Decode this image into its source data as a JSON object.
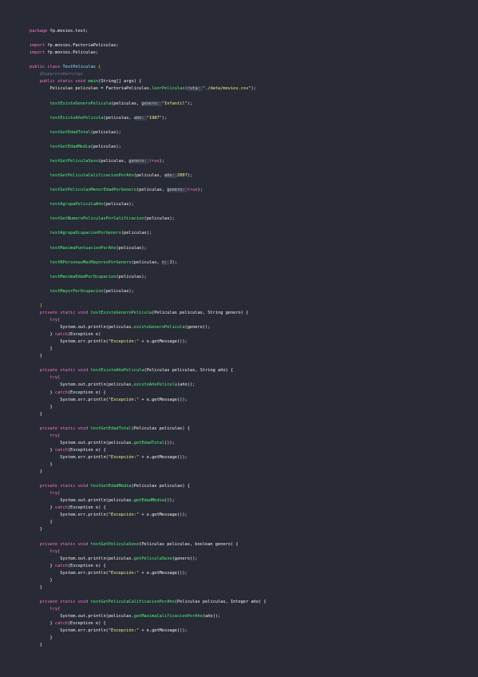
{
  "colors": {
    "background": "#282a36",
    "keyword": "#ff79c6",
    "type": "#8be9fd",
    "method": "#50fa7b",
    "string": "#f1fa8c",
    "plain": "#f8f8f2",
    "annotation": "#6272a4"
  },
  "code_lines": [
    [
      {
        "t": "package ",
        "k": "kw"
      },
      {
        "t": "fp.movies.test;",
        "k": "pl"
      }
    ],
    [],
    [
      {
        "t": "import ",
        "k": "kw"
      },
      {
        "t": "fp.movies.FactoriaPeliculas;",
        "k": "pl"
      }
    ],
    [
      {
        "t": "import ",
        "k": "kw"
      },
      {
        "t": "fp.movies.Peliculas;",
        "k": "pl"
      }
    ],
    [],
    [
      {
        "t": "public ",
        "k": "kw"
      },
      {
        "t": "class ",
        "k": "kw"
      },
      {
        "t": "TestPeliculas ",
        "k": "ty"
      },
      {
        "t": "{",
        "k": "br"
      }
    ],
    [
      {
        "t": "    @SuppressWarnings",
        "k": "an"
      }
    ],
    [
      {
        "t": "    public static void ",
        "k": "kw"
      },
      {
        "t": "main",
        "k": "fn"
      },
      {
        "t": "(String[] ",
        "k": "pl"
      },
      {
        "t": "args",
        "k": "pl"
      },
      {
        "t": ") {",
        "k": "pl"
      }
    ],
    [
      {
        "t": "        Peliculas peliculas = FactoriaPeliculas.",
        "k": "pl"
      },
      {
        "t": "leerPeliculas",
        "k": "fn"
      },
      {
        "t": "(",
        "k": "pl"
      },
      {
        "t": "ruta: ",
        "k": "hint"
      },
      {
        "t": "\"./data/movies.csv\"",
        "k": "str"
      },
      {
        "t": ");",
        "k": "pl"
      }
    ],
    [],
    [
      {
        "t": "        ",
        "k": "pl"
      },
      {
        "t": "testExisteGeneroPelicula",
        "k": "fn"
      },
      {
        "t": "(peliculas, ",
        "k": "pl"
      },
      {
        "t": "genero: ",
        "k": "hint"
      },
      {
        "t": "\"Infantil\"",
        "k": "str"
      },
      {
        "t": ");",
        "k": "pl"
      }
    ],
    [],
    [
      {
        "t": "        ",
        "k": "pl"
      },
      {
        "t": "testExisteAñoPelicula",
        "k": "fn"
      },
      {
        "t": "(peliculas, ",
        "k": "pl"
      },
      {
        "t": "año: ",
        "k": "hint"
      },
      {
        "t": "\"1987\"",
        "k": "str"
      },
      {
        "t": ");",
        "k": "pl"
      }
    ],
    [],
    [
      {
        "t": "        ",
        "k": "pl"
      },
      {
        "t": "testGetEdadTotal",
        "k": "fn"
      },
      {
        "t": "(peliculas);",
        "k": "pl"
      }
    ],
    [],
    [
      {
        "t": "        ",
        "k": "pl"
      },
      {
        "t": "testGetEdadMedia",
        "k": "fn"
      },
      {
        "t": "(peliculas);",
        "k": "pl"
      }
    ],
    [],
    [
      {
        "t": "        ",
        "k": "pl"
      },
      {
        "t": "testGetPeliculaSexo",
        "k": "fn"
      },
      {
        "t": "(peliculas, ",
        "k": "pl"
      },
      {
        "t": "genero: ",
        "k": "hint"
      },
      {
        "t": "true",
        "k": "kw"
      },
      {
        "t": ");",
        "k": "pl"
      }
    ],
    [],
    [
      {
        "t": "        ",
        "k": "pl"
      },
      {
        "t": "testGetPeliculaCalificacionPorAño",
        "k": "fn"
      },
      {
        "t": "(peliculas, ",
        "k": "pl"
      },
      {
        "t": "año: ",
        "k": "hint"
      },
      {
        "t": "2007",
        "k": "str"
      },
      {
        "t": ");",
        "k": "pl"
      }
    ],
    [],
    [
      {
        "t": "        ",
        "k": "pl"
      },
      {
        "t": "testGetPeliculasMenorEdadPorGenero",
        "k": "fn"
      },
      {
        "t": "(peliculas, ",
        "k": "pl"
      },
      {
        "t": "genero: ",
        "k": "hint"
      },
      {
        "t": "true",
        "k": "kw"
      },
      {
        "t": ");",
        "k": "pl"
      }
    ],
    [],
    [
      {
        "t": "        ",
        "k": "pl"
      },
      {
        "t": "testAgrupaPeliculaAño",
        "k": "fn"
      },
      {
        "t": "(peliculas);",
        "k": "pl"
      }
    ],
    [],
    [
      {
        "t": "        ",
        "k": "pl"
      },
      {
        "t": "testGetNumeroPeliculasPorCalificacion",
        "k": "fn"
      },
      {
        "t": "(peliculas);",
        "k": "pl"
      }
    ],
    [],
    [
      {
        "t": "        ",
        "k": "pl"
      },
      {
        "t": "testAgrupaOcupacionPorGenero",
        "k": "fn"
      },
      {
        "t": "(peliculas);",
        "k": "pl"
      }
    ],
    [],
    [
      {
        "t": "        ",
        "k": "pl"
      },
      {
        "t": "testMaximaPuntuacionPorAño",
        "k": "fn"
      },
      {
        "t": "(peliculas);",
        "k": "pl"
      }
    ],
    [],
    [
      {
        "t": "        ",
        "k": "pl"
      },
      {
        "t": "testNPersonasMasMayoresPorGenero",
        "k": "fn"
      },
      {
        "t": "(peliculas, ",
        "k": "pl"
      },
      {
        "t": "n: ",
        "k": "hint"
      },
      {
        "t": "3",
        "k": "str"
      },
      {
        "t": ");",
        "k": "pl"
      }
    ],
    [],
    [
      {
        "t": "        ",
        "k": "pl"
      },
      {
        "t": "testMaximaEdadPorOcupacion",
        "k": "fn"
      },
      {
        "t": "(peliculas);",
        "k": "pl"
      }
    ],
    [],
    [
      {
        "t": "        ",
        "k": "pl"
      },
      {
        "t": "testMayorPorOcupacion",
        "k": "fn"
      },
      {
        "t": "(peliculas);",
        "k": "pl"
      }
    ],
    [],
    [
      {
        "t": "    }",
        "k": "br"
      }
    ],
    [
      {
        "t": "    private static void ",
        "k": "kw"
      },
      {
        "t": "testExisteGeneroPelicula",
        "k": "fn"
      },
      {
        "t": "(Peliculas peliculas, String genero) {",
        "k": "pl"
      }
    ],
    [
      {
        "t": "        try{",
        "k": "kw"
      }
    ],
    [
      {
        "t": "            System.out.println(peliculas.",
        "k": "pl"
      },
      {
        "t": "existeGeneroPelicula",
        "k": "fn"
      },
      {
        "t": "(genero));",
        "k": "pl"
      }
    ],
    [
      {
        "t": "        } ",
        "k": "pl"
      },
      {
        "t": "catch",
        "k": "kw"
      },
      {
        "t": "(Exception e)",
        "k": "pl"
      }
    ],
    [
      {
        "t": "            System.err.println(",
        "k": "pl"
      },
      {
        "t": "\"Excepción:\"",
        "k": "str"
      },
      {
        "t": " + e.getMessage());",
        "k": "pl"
      }
    ],
    [
      {
        "t": "        }",
        "k": "pl"
      }
    ],
    [
      {
        "t": "    }",
        "k": "pl"
      }
    ],
    [],
    [
      {
        "t": "    private static void ",
        "k": "kw"
      },
      {
        "t": "testExisteAñoPelicula",
        "k": "fn"
      },
      {
        "t": "(Peliculas peliculas, String año) {",
        "k": "pl"
      }
    ],
    [
      {
        "t": "        try{",
        "k": "kw"
      }
    ],
    [
      {
        "t": "            System.out.println(peliculas.",
        "k": "pl"
      },
      {
        "t": "existeAñoPelicula",
        "k": "fn"
      },
      {
        "t": "(año));",
        "k": "pl"
      }
    ],
    [
      {
        "t": "        } ",
        "k": "pl"
      },
      {
        "t": "catch",
        "k": "kw"
      },
      {
        "t": "(Exception e) {",
        "k": "pl"
      }
    ],
    [
      {
        "t": "            System.err.println(",
        "k": "pl"
      },
      {
        "t": "\"Excepción:\"",
        "k": "str"
      },
      {
        "t": " + e.getMessage());",
        "k": "pl"
      }
    ],
    [
      {
        "t": "        }",
        "k": "pl"
      }
    ],
    [
      {
        "t": "    }",
        "k": "pl"
      }
    ],
    [],
    [
      {
        "t": "    private static void ",
        "k": "kw"
      },
      {
        "t": "testGetEdadTotal",
        "k": "fn"
      },
      {
        "t": "(Peliculas peliculas) {",
        "k": "pl"
      }
    ],
    [
      {
        "t": "        try{",
        "k": "kw"
      }
    ],
    [
      {
        "t": "            System.out.println(peliculas.",
        "k": "pl"
      },
      {
        "t": "getEdadTotal",
        "k": "fn"
      },
      {
        "t": "());",
        "k": "pl"
      }
    ],
    [
      {
        "t": "        } ",
        "k": "pl"
      },
      {
        "t": "catch",
        "k": "kw"
      },
      {
        "t": "(Exception e) {",
        "k": "pl"
      }
    ],
    [
      {
        "t": "            System.err.println(",
        "k": "pl"
      },
      {
        "t": "\"Excepción:\"",
        "k": "str"
      },
      {
        "t": " + e.getMessage());",
        "k": "pl"
      }
    ],
    [
      {
        "t": "        }",
        "k": "pl"
      }
    ],
    [
      {
        "t": "    }",
        "k": "pl"
      }
    ],
    [],
    [
      {
        "t": "    private static void ",
        "k": "kw"
      },
      {
        "t": "testGetEdadMedia",
        "k": "fn"
      },
      {
        "t": "(Peliculas peliculas) {",
        "k": "pl"
      }
    ],
    [
      {
        "t": "        try{",
        "k": "kw"
      }
    ],
    [
      {
        "t": "            System.out.println(peliculas.",
        "k": "pl"
      },
      {
        "t": "getEdadMedia",
        "k": "fn"
      },
      {
        "t": "());",
        "k": "pl"
      }
    ],
    [
      {
        "t": "        } ",
        "k": "pl"
      },
      {
        "t": "catch",
        "k": "kw"
      },
      {
        "t": "(Exception e) {",
        "k": "pl"
      }
    ],
    [
      {
        "t": "            System.err.println(",
        "k": "pl"
      },
      {
        "t": "\"Excepción:\"",
        "k": "str"
      },
      {
        "t": " + e.getMessage());",
        "k": "pl"
      }
    ],
    [
      {
        "t": "        }",
        "k": "pl"
      }
    ],
    [
      {
        "t": "    }",
        "k": "pl"
      }
    ],
    [],
    [
      {
        "t": "    private static void ",
        "k": "kw"
      },
      {
        "t": "testGetPeliculaSexo",
        "k": "fn"
      },
      {
        "t": "(Peliculas peliculas, boolean genero) {",
        "k": "pl"
      }
    ],
    [
      {
        "t": "        try{",
        "k": "kw"
      }
    ],
    [
      {
        "t": "            System.out.println(peliculas.",
        "k": "pl"
      },
      {
        "t": "getPeliculaSexo",
        "k": "fn"
      },
      {
        "t": "(genero));",
        "k": "pl"
      }
    ],
    [
      {
        "t": "        } ",
        "k": "pl"
      },
      {
        "t": "catch",
        "k": "kw"
      },
      {
        "t": "(Exception e) {",
        "k": "pl"
      }
    ],
    [
      {
        "t": "            System.err.println(",
        "k": "pl"
      },
      {
        "t": "\"Excepción:\"",
        "k": "str"
      },
      {
        "t": " + e.getMessage());",
        "k": "pl"
      }
    ],
    [
      {
        "t": "        }",
        "k": "pl"
      }
    ],
    [
      {
        "t": "    }",
        "k": "pl"
      }
    ],
    [],
    [
      {
        "t": "    private static void ",
        "k": "kw"
      },
      {
        "t": "testGetPeliculaCalificacionPorAño",
        "k": "fn"
      },
      {
        "t": "(Peliculas peliculas, Integer año) {",
        "k": "pl"
      }
    ],
    [
      {
        "t": "        try{",
        "k": "kw"
      }
    ],
    [
      {
        "t": "            System.out.println(peliculas.",
        "k": "pl"
      },
      {
        "t": "getMaximaCalificacionPorAño",
        "k": "fn"
      },
      {
        "t": "(año));",
        "k": "pl"
      }
    ],
    [
      {
        "t": "        } ",
        "k": "pl"
      },
      {
        "t": "catch",
        "k": "kw"
      },
      {
        "t": "(Exception e) {",
        "k": "pl"
      }
    ],
    [
      {
        "t": "            System.err.println(",
        "k": "pl"
      },
      {
        "t": "\"Excepción:\"",
        "k": "str"
      },
      {
        "t": " + e.getMessage());",
        "k": "pl"
      }
    ],
    [
      {
        "t": "        }",
        "k": "pl"
      }
    ],
    [
      {
        "t": "    }",
        "k": "pl"
      }
    ]
  ]
}
